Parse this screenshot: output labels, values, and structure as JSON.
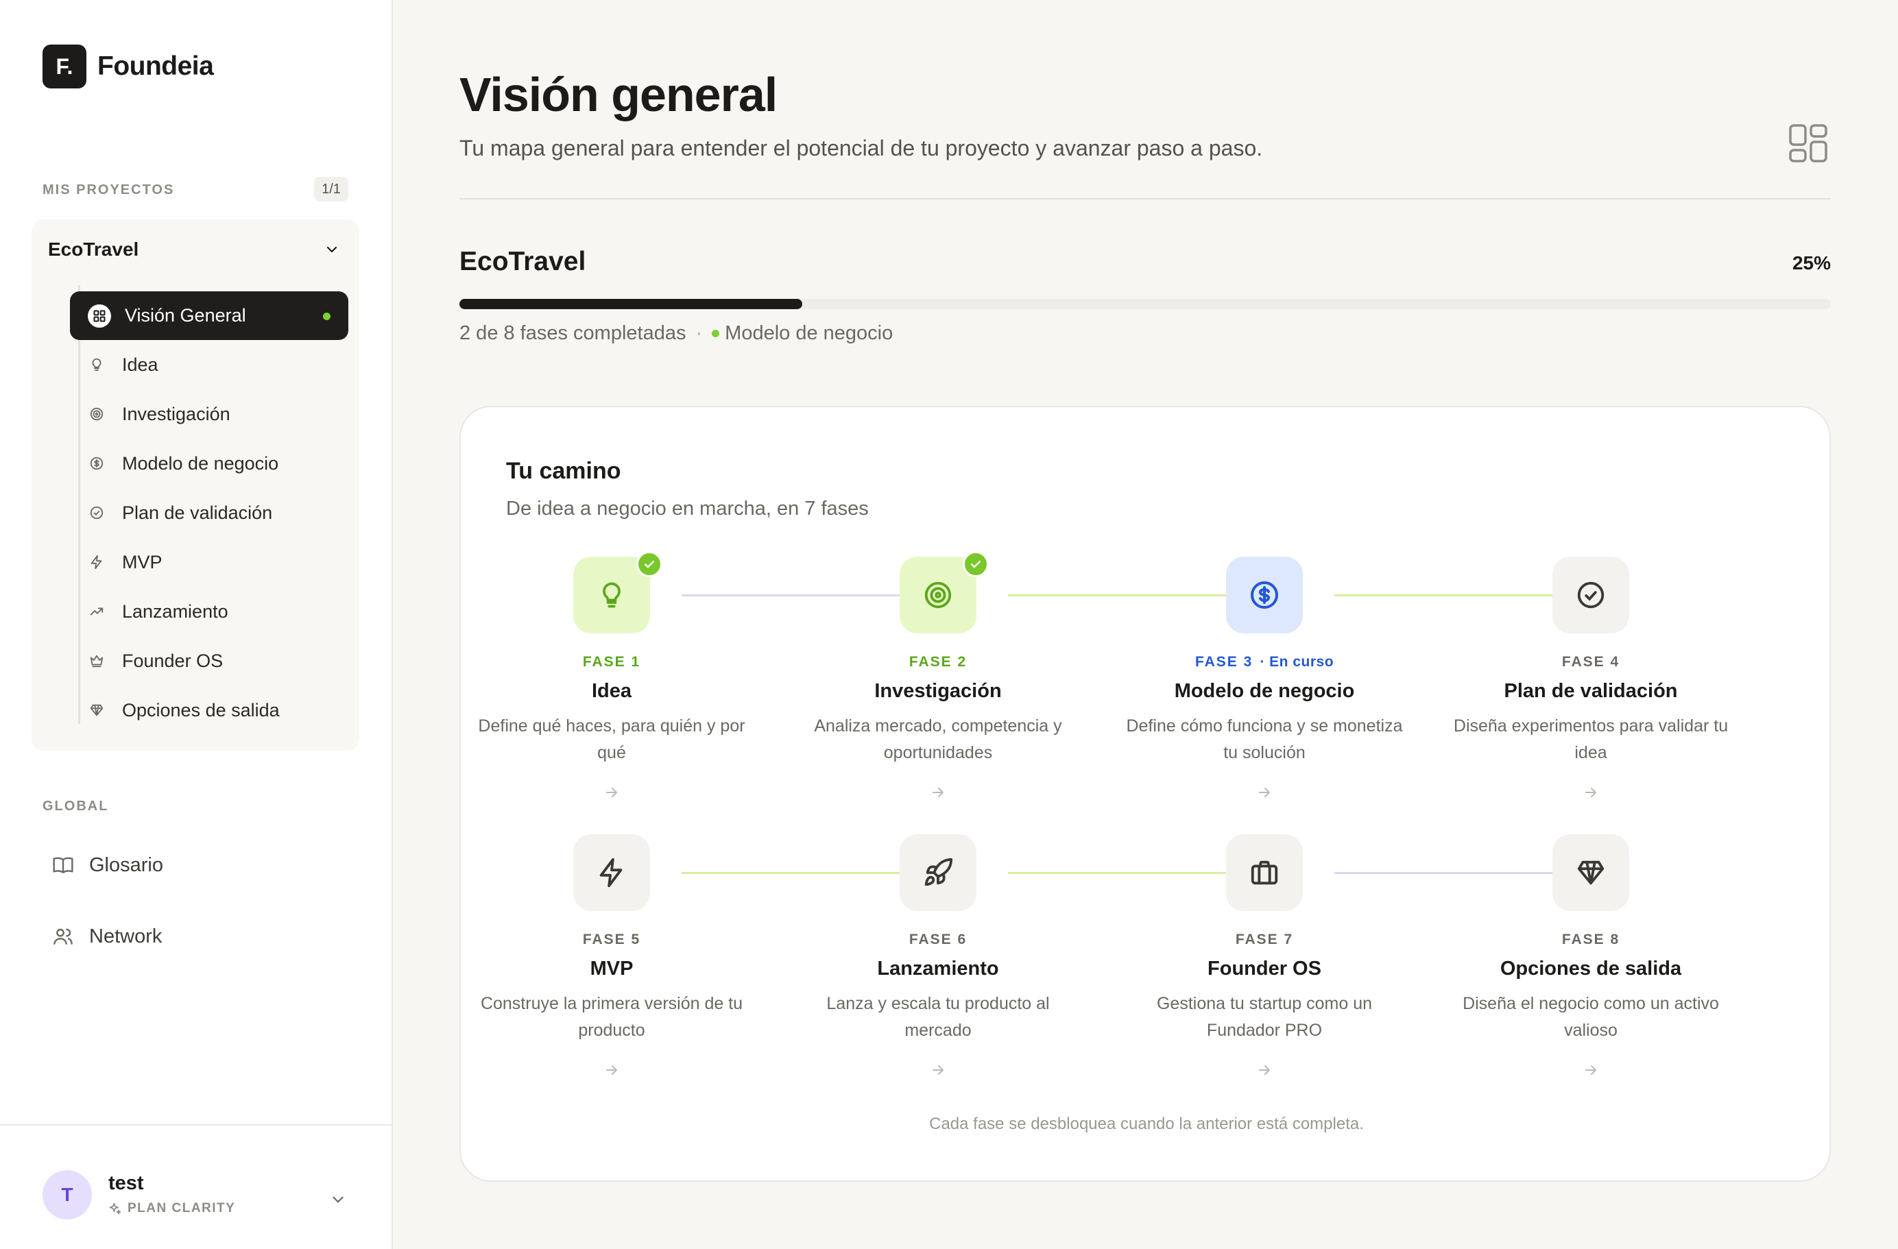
{
  "app": {
    "logo_mark": "F.",
    "name": "Foundeia"
  },
  "sidebar": {
    "projects_label": "MIS PROYECTOS",
    "projects_count": "1/1",
    "project_name": "EcoTravel",
    "nav": [
      {
        "label": "Visión General",
        "icon": "grid-icon",
        "active": true
      },
      {
        "label": "Idea",
        "icon": "lightbulb-icon"
      },
      {
        "label": "Investigación",
        "icon": "target-icon"
      },
      {
        "label": "Modelo de negocio",
        "icon": "dollar-circle-icon"
      },
      {
        "label": "Plan de validación",
        "icon": "check-circle-icon"
      },
      {
        "label": "MVP",
        "icon": "bolt-icon"
      },
      {
        "label": "Lanzamiento",
        "icon": "trending-up-icon"
      },
      {
        "label": "Founder OS",
        "icon": "crown-icon"
      },
      {
        "label": "Opciones de salida",
        "icon": "diamond-icon"
      }
    ],
    "global_label": "GLOBAL",
    "global_items": [
      {
        "label": "Glosario",
        "icon": "book-icon"
      },
      {
        "label": "Network",
        "icon": "users-icon"
      }
    ],
    "user": {
      "initial": "T",
      "name": "test",
      "plan": "PLAN CLARITY"
    }
  },
  "main": {
    "title": "Visión general",
    "subtitle": "Tu mapa general para entender el potencial de tu proyecto y avanzar paso a paso.",
    "project": {
      "name": "EcoTravel",
      "progress_percent": 25,
      "progress_label": "25%",
      "phases_completed": "2 de 8 fases completadas",
      "separator": "·",
      "current_phase": "Modelo de negocio"
    },
    "path": {
      "title": "Tu camino",
      "subtitle": "De idea a negocio en marcha, en 7 fases",
      "footer": "Cada fase se desbloquea cuando la anterior está completa.",
      "phases": [
        {
          "label": "FASE 1",
          "name": "Idea",
          "desc": "Define qué haces, para quién y por qué",
          "state": "done",
          "icon": "lightbulb-icon"
        },
        {
          "label": "FASE 2",
          "name": "Investigación",
          "desc": "Analiza mercado, competencia y oportunidades",
          "state": "done",
          "icon": "target-icon"
        },
        {
          "label": "FASE 3",
          "status": "· En curso",
          "name": "Modelo de negocio",
          "desc": "Define cómo funciona y se monetiza tu solución",
          "state": "current",
          "icon": "dollar-circle-icon"
        },
        {
          "label": "FASE 4",
          "name": "Plan de validación",
          "desc": "Diseña experimentos para validar tu idea",
          "state": "locked",
          "icon": "check-circle-icon"
        },
        {
          "label": "FASE 5",
          "name": "MVP",
          "desc": "Construye la primera versión de tu producto",
          "state": "locked",
          "icon": "bolt-icon"
        },
        {
          "label": "FASE 6",
          "name": "Lanzamiento",
          "desc": "Lanza y escala tu producto al mercado",
          "state": "locked",
          "icon": "rocket-icon"
        },
        {
          "label": "FASE 7",
          "name": "Founder OS",
          "desc": "Gestiona tu startup como un Fundador PRO",
          "state": "locked",
          "icon": "briefcase-icon"
        },
        {
          "label": "FASE 8",
          "name": "Opciones de salida",
          "desc": "Diseña el negocio como un activo valioso",
          "state": "locked",
          "icon": "diamond-icon"
        }
      ]
    }
  },
  "colors": {
    "accent_green": "#7bd132",
    "current_blue": "#2457d6",
    "dark": "#1c1b19"
  }
}
